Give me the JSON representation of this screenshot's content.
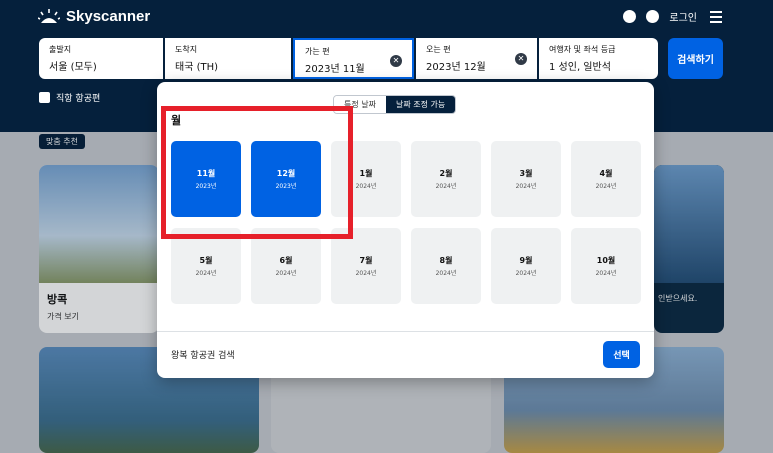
{
  "header": {
    "brand": "Skyscanner",
    "login_label": "로그인"
  },
  "search": {
    "from": {
      "label": "출발지",
      "value": "서울 (모두)"
    },
    "to": {
      "label": "도착지",
      "value": "태국 (TH)"
    },
    "depart": {
      "label": "가는 편",
      "value": "2023년 11월"
    },
    "return": {
      "label": "오는 편",
      "value": "2023년 12월"
    },
    "travelers": {
      "label": "여행자 및 좌석 등급",
      "value": "1 성인, 일반석"
    },
    "search_button": "검색하기",
    "direct_label": "직항 항공편"
  },
  "background": {
    "chip": "맞춤 추천",
    "card1_title": "방콕",
    "card1_sub": "가격 보기",
    "card2_text": "인받으세요."
  },
  "picker": {
    "toggle_specific": "특정 날짜",
    "toggle_flexible": "날짜 조정 가능",
    "section_title": "월",
    "months": [
      {
        "month": "11월",
        "year": "2023년"
      },
      {
        "month": "12월",
        "year": "2023년"
      },
      {
        "month": "1월",
        "year": "2024년"
      },
      {
        "month": "2월",
        "year": "2024년"
      },
      {
        "month": "3월",
        "year": "2024년"
      },
      {
        "month": "4월",
        "year": "2024년"
      },
      {
        "month": "5월",
        "year": "2024년"
      },
      {
        "month": "6월",
        "year": "2024년"
      },
      {
        "month": "7월",
        "year": "2024년"
      },
      {
        "month": "8월",
        "year": "2024년"
      },
      {
        "month": "9월",
        "year": "2024년"
      },
      {
        "month": "10월",
        "year": "2024년"
      }
    ],
    "footer_text": "왕복 항공권 검색",
    "select_button": "선택"
  },
  "colors": {
    "brand_navy": "#05203c",
    "accent_blue": "#0062e3",
    "highlight_red": "#e6202a"
  }
}
